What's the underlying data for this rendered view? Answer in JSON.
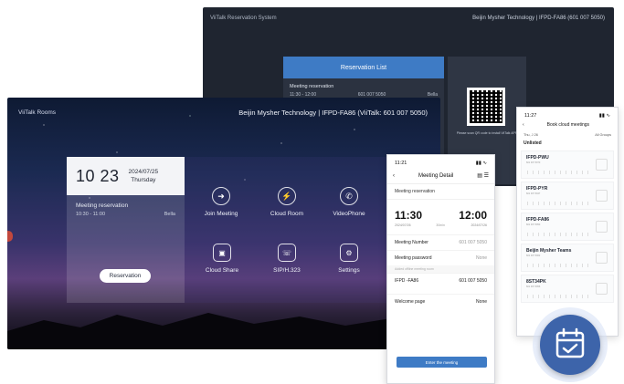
{
  "back_screen": {
    "title": "ViiTalk Reservation System",
    "company": "Beijin Mysher Technology | IFPD-FA86 (601 007 5050)",
    "list_header": "Reservation List",
    "item": {
      "title": "Meeting reservation",
      "time": "11:30 - 12:00",
      "number": "601 007 5050",
      "host": "Bella"
    },
    "qr_text": "Please scan QR code to install ViiTalk APP"
  },
  "main_screen": {
    "app_title": "ViiTalk Rooms",
    "company": "Beijin Mysher Technology | IFPD-FA86 (ViiTalk: 601 007 5050)",
    "time": "10 23",
    "date": "2024/07/25",
    "weekday": "Thursday",
    "reservation": {
      "title": "Meeting reservation",
      "time": "10:30 - 11:00",
      "host": "Bella"
    },
    "reserve_button": "Reservation",
    "tiles": [
      "Join Meeting",
      "Cloud Room",
      "VideoPhone",
      "Cloud Share",
      "SIP/H.323",
      "Settings"
    ]
  },
  "phone_detail": {
    "status_time": "11:21",
    "title": "Meeting Detail",
    "section": "Meeting reservation",
    "start": "11:30",
    "start_date": "2024/07/26",
    "end": "12:00",
    "end_date": "2024/07/26",
    "duration": "30min",
    "rows": [
      {
        "label": "Meeting Number",
        "value": "601 007 5050"
      },
      {
        "label": "Meeting password",
        "value": "None"
      }
    ],
    "note": "Added offline meeting room",
    "device": {
      "label": "IFPD -FA86",
      "value": "601 007 5050"
    },
    "welcome": {
      "label": "Welcome page",
      "value": "None"
    },
    "enter_button": "Enter the meeting"
  },
  "phone_book": {
    "status_time": "11:27",
    "title": "Book cloud meetings",
    "filter_date": "Thu, J 26",
    "filter_groups": "All Groups",
    "group": "Unlisted",
    "rooms": [
      {
        "name": "IFPD-PWU",
        "sub": "601 007 5070"
      },
      {
        "name": "IFPD-PYR",
        "sub": "601 007 5047"
      },
      {
        "name": "IFPD-FA86",
        "sub": "601 007 5050"
      },
      {
        "name": "Beijin Mysher Teams",
        "sub": "601 007 5062"
      },
      {
        "name": "8ST34PK",
        "sub": "601 007 5056"
      }
    ]
  },
  "colors": {
    "accent": "#3e7bc5",
    "badge": "#3d64aa"
  }
}
